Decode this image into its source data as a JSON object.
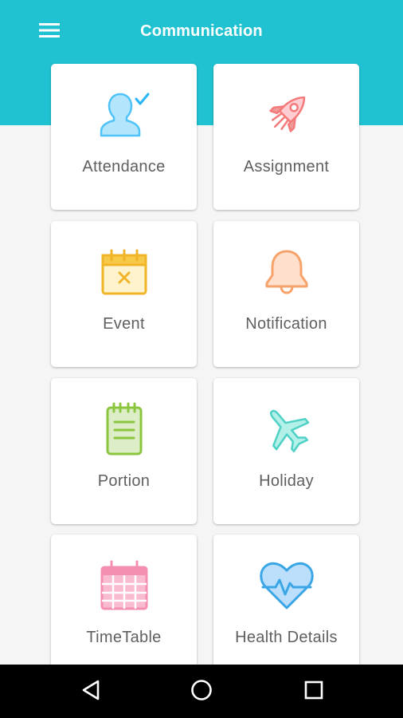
{
  "app": {
    "title": "Communication"
  },
  "header": {
    "menu_icon": "menu-icon"
  },
  "tiles": [
    {
      "label": "Attendance",
      "icon": "user-check-icon",
      "color": "#5ac8f0"
    },
    {
      "label": "Assignment",
      "icon": "rocket-icon",
      "color": "#f47a7a"
    },
    {
      "label": "Event",
      "icon": "calendar-x-icon",
      "color": "#f0b429"
    },
    {
      "label": "Notification",
      "icon": "bell-icon",
      "color": "#f6a26a"
    },
    {
      "label": "Portion",
      "icon": "notepad-icon",
      "color": "#8cc63f"
    },
    {
      "label": "Holiday",
      "icon": "airplane-icon",
      "color": "#4fd1c5"
    },
    {
      "label": "TimeTable",
      "icon": "calendar-grid-icon",
      "color": "#f48fb1"
    },
    {
      "label": "Health Details",
      "icon": "heart-pulse-icon",
      "color": "#3ba6e6"
    }
  ],
  "system_nav": {
    "back_icon": "back-triangle-icon",
    "home_icon": "home-circle-icon",
    "recents_icon": "recents-square-icon"
  },
  "colors": {
    "accent": "#20c2d1",
    "background": "#f5f5f5",
    "label": "#5f5f5f"
  }
}
